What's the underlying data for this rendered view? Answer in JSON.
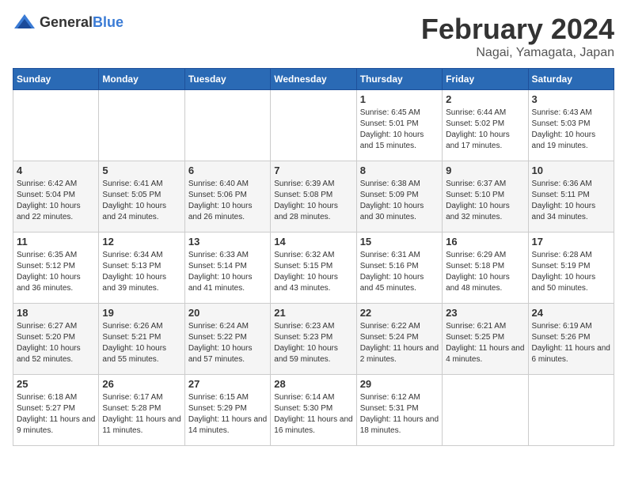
{
  "header": {
    "logo_general": "General",
    "logo_blue": "Blue",
    "main_title": "February 2024",
    "sub_title": "Nagai, Yamagata, Japan"
  },
  "weekdays": [
    "Sunday",
    "Monday",
    "Tuesday",
    "Wednesday",
    "Thursday",
    "Friday",
    "Saturday"
  ],
  "weeks": [
    [
      {
        "day": "",
        "info": ""
      },
      {
        "day": "",
        "info": ""
      },
      {
        "day": "",
        "info": ""
      },
      {
        "day": "",
        "info": ""
      },
      {
        "day": "1",
        "info": "Sunrise: 6:45 AM\nSunset: 5:01 PM\nDaylight: 10 hours and 15 minutes."
      },
      {
        "day": "2",
        "info": "Sunrise: 6:44 AM\nSunset: 5:02 PM\nDaylight: 10 hours and 17 minutes."
      },
      {
        "day": "3",
        "info": "Sunrise: 6:43 AM\nSunset: 5:03 PM\nDaylight: 10 hours and 19 minutes."
      }
    ],
    [
      {
        "day": "4",
        "info": "Sunrise: 6:42 AM\nSunset: 5:04 PM\nDaylight: 10 hours and 22 minutes."
      },
      {
        "day": "5",
        "info": "Sunrise: 6:41 AM\nSunset: 5:05 PM\nDaylight: 10 hours and 24 minutes."
      },
      {
        "day": "6",
        "info": "Sunrise: 6:40 AM\nSunset: 5:06 PM\nDaylight: 10 hours and 26 minutes."
      },
      {
        "day": "7",
        "info": "Sunrise: 6:39 AM\nSunset: 5:08 PM\nDaylight: 10 hours and 28 minutes."
      },
      {
        "day": "8",
        "info": "Sunrise: 6:38 AM\nSunset: 5:09 PM\nDaylight: 10 hours and 30 minutes."
      },
      {
        "day": "9",
        "info": "Sunrise: 6:37 AM\nSunset: 5:10 PM\nDaylight: 10 hours and 32 minutes."
      },
      {
        "day": "10",
        "info": "Sunrise: 6:36 AM\nSunset: 5:11 PM\nDaylight: 10 hours and 34 minutes."
      }
    ],
    [
      {
        "day": "11",
        "info": "Sunrise: 6:35 AM\nSunset: 5:12 PM\nDaylight: 10 hours and 36 minutes."
      },
      {
        "day": "12",
        "info": "Sunrise: 6:34 AM\nSunset: 5:13 PM\nDaylight: 10 hours and 39 minutes."
      },
      {
        "day": "13",
        "info": "Sunrise: 6:33 AM\nSunset: 5:14 PM\nDaylight: 10 hours and 41 minutes."
      },
      {
        "day": "14",
        "info": "Sunrise: 6:32 AM\nSunset: 5:15 PM\nDaylight: 10 hours and 43 minutes."
      },
      {
        "day": "15",
        "info": "Sunrise: 6:31 AM\nSunset: 5:16 PM\nDaylight: 10 hours and 45 minutes."
      },
      {
        "day": "16",
        "info": "Sunrise: 6:29 AM\nSunset: 5:18 PM\nDaylight: 10 hours and 48 minutes."
      },
      {
        "day": "17",
        "info": "Sunrise: 6:28 AM\nSunset: 5:19 PM\nDaylight: 10 hours and 50 minutes."
      }
    ],
    [
      {
        "day": "18",
        "info": "Sunrise: 6:27 AM\nSunset: 5:20 PM\nDaylight: 10 hours and 52 minutes."
      },
      {
        "day": "19",
        "info": "Sunrise: 6:26 AM\nSunset: 5:21 PM\nDaylight: 10 hours and 55 minutes."
      },
      {
        "day": "20",
        "info": "Sunrise: 6:24 AM\nSunset: 5:22 PM\nDaylight: 10 hours and 57 minutes."
      },
      {
        "day": "21",
        "info": "Sunrise: 6:23 AM\nSunset: 5:23 PM\nDaylight: 10 hours and 59 minutes."
      },
      {
        "day": "22",
        "info": "Sunrise: 6:22 AM\nSunset: 5:24 PM\nDaylight: 11 hours and 2 minutes."
      },
      {
        "day": "23",
        "info": "Sunrise: 6:21 AM\nSunset: 5:25 PM\nDaylight: 11 hours and 4 minutes."
      },
      {
        "day": "24",
        "info": "Sunrise: 6:19 AM\nSunset: 5:26 PM\nDaylight: 11 hours and 6 minutes."
      }
    ],
    [
      {
        "day": "25",
        "info": "Sunrise: 6:18 AM\nSunset: 5:27 PM\nDaylight: 11 hours and 9 minutes."
      },
      {
        "day": "26",
        "info": "Sunrise: 6:17 AM\nSunset: 5:28 PM\nDaylight: 11 hours and 11 minutes."
      },
      {
        "day": "27",
        "info": "Sunrise: 6:15 AM\nSunset: 5:29 PM\nDaylight: 11 hours and 14 minutes."
      },
      {
        "day": "28",
        "info": "Sunrise: 6:14 AM\nSunset: 5:30 PM\nDaylight: 11 hours and 16 minutes."
      },
      {
        "day": "29",
        "info": "Sunrise: 6:12 AM\nSunset: 5:31 PM\nDaylight: 11 hours and 18 minutes."
      },
      {
        "day": "",
        "info": ""
      },
      {
        "day": "",
        "info": ""
      }
    ]
  ]
}
